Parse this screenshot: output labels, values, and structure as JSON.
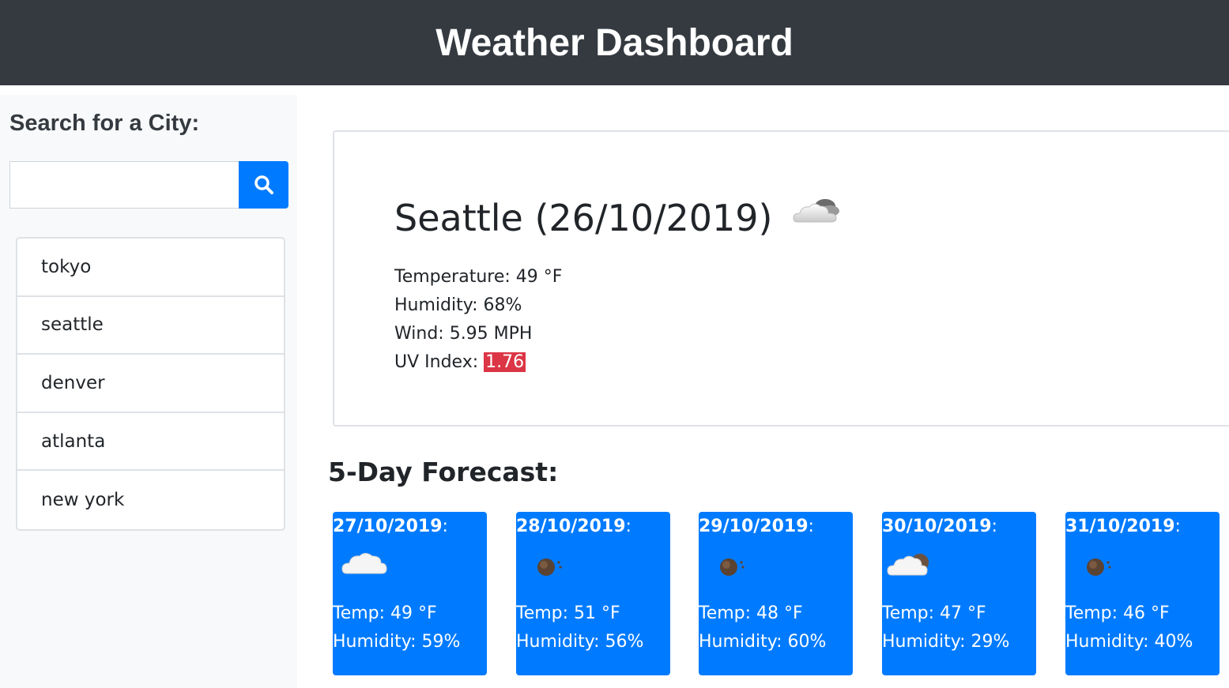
{
  "header": {
    "title": "Weather Dashboard"
  },
  "sidebar": {
    "heading": "Search for a City:",
    "search_value": "",
    "history": [
      "tokyo",
      "seattle",
      "denver",
      "atlanta",
      "new york"
    ]
  },
  "current": {
    "title": "Seattle (26/10/2019)",
    "icon": "cloud-sun-icon",
    "temperature": "Temperature: 49 °F",
    "humidity": "Humidity: 68%",
    "wind": "Wind: 5.95 MPH",
    "uv_label": "UV Index: ",
    "uv_value": "1.76"
  },
  "forecast": {
    "heading": "5-Day Forecast:",
    "days": [
      {
        "date": "27/10/2019",
        "icon": "cloud-icon",
        "temp": "Temp: 49 °F",
        "humidity": "Humidity: 59%"
      },
      {
        "date": "28/10/2019",
        "icon": "moon-icon",
        "temp": "Temp: 51 °F",
        "humidity": "Humidity: 56%"
      },
      {
        "date": "29/10/2019",
        "icon": "moon-icon",
        "temp": "Temp: 48 °F",
        "humidity": "Humidity: 60%"
      },
      {
        "date": "30/10/2019",
        "icon": "cloud-moon-icon",
        "temp": "Temp: 47 °F",
        "humidity": "Humidity: 29%"
      },
      {
        "date": "31/10/2019",
        "icon": "moon-icon",
        "temp": "Temp: 46 °F",
        "humidity": "Humidity: 40%"
      }
    ]
  },
  "colors": {
    "header_bg": "#343a40",
    "primary": "#007bff",
    "uv_badge": "#dc3545"
  }
}
